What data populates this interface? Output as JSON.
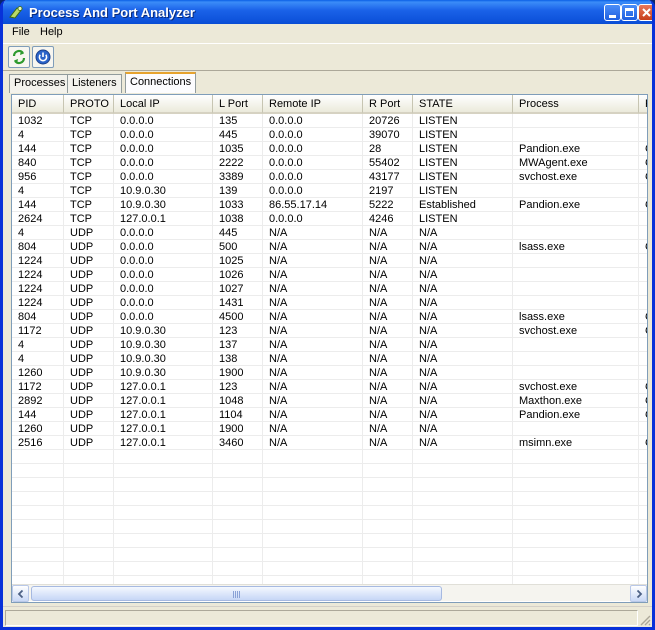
{
  "window": {
    "title": "Process And Port Analyzer"
  },
  "menu": {
    "items": [
      {
        "label": "File"
      },
      {
        "label": "Help"
      }
    ]
  },
  "toolbar": {
    "buttons": [
      {
        "icon": "refresh-icon"
      },
      {
        "icon": "power-icon"
      }
    ]
  },
  "tabs": [
    {
      "label": "Processes",
      "active": false
    },
    {
      "label": "Listeners",
      "active": false
    },
    {
      "label": "Connections",
      "active": true
    }
  ],
  "table": {
    "columns": [
      "PID",
      "PROTO",
      "Local IP",
      "L Port",
      "Remote IP",
      "R Port",
      "STATE",
      "Process",
      "F"
    ],
    "rows": [
      [
        "1032",
        "TCP",
        "0.0.0.0",
        "135",
        "0.0.0.0",
        "20726",
        "LISTEN",
        "",
        ""
      ],
      [
        "4",
        "TCP",
        "0.0.0.0",
        "445",
        "0.0.0.0",
        "39070",
        "LISTEN",
        "",
        ""
      ],
      [
        "144",
        "TCP",
        "0.0.0.0",
        "1035",
        "0.0.0.0",
        "28",
        "LISTEN",
        "Pandion.exe",
        "C"
      ],
      [
        "840",
        "TCP",
        "0.0.0.0",
        "2222",
        "0.0.0.0",
        "55402",
        "LISTEN",
        "MWAgent.exe",
        "C"
      ],
      [
        "956",
        "TCP",
        "0.0.0.0",
        "3389",
        "0.0.0.0",
        "43177",
        "LISTEN",
        "svchost.exe",
        "C"
      ],
      [
        "4",
        "TCP",
        "10.9.0.30",
        "139",
        "0.0.0.0",
        "2197",
        "LISTEN",
        "",
        ""
      ],
      [
        "144",
        "TCP",
        "10.9.0.30",
        "1033",
        "86.55.17.14",
        "5222",
        "Established",
        "Pandion.exe",
        "C"
      ],
      [
        "2624",
        "TCP",
        "127.0.0.1",
        "1038",
        "0.0.0.0",
        "4246",
        "LISTEN",
        "",
        ""
      ],
      [
        "4",
        "UDP",
        "0.0.0.0",
        "445",
        "N/A",
        "N/A",
        "N/A",
        "",
        ""
      ],
      [
        "804",
        "UDP",
        "0.0.0.0",
        "500",
        "N/A",
        "N/A",
        "N/A",
        "lsass.exe",
        "C"
      ],
      [
        "1224",
        "UDP",
        "0.0.0.0",
        "1025",
        "N/A",
        "N/A",
        "N/A",
        "",
        ""
      ],
      [
        "1224",
        "UDP",
        "0.0.0.0",
        "1026",
        "N/A",
        "N/A",
        "N/A",
        "",
        ""
      ],
      [
        "1224",
        "UDP",
        "0.0.0.0",
        "1027",
        "N/A",
        "N/A",
        "N/A",
        "",
        ""
      ],
      [
        "1224",
        "UDP",
        "0.0.0.0",
        "1431",
        "N/A",
        "N/A",
        "N/A",
        "",
        ""
      ],
      [
        "804",
        "UDP",
        "0.0.0.0",
        "4500",
        "N/A",
        "N/A",
        "N/A",
        "lsass.exe",
        "C"
      ],
      [
        "1172",
        "UDP",
        "10.9.0.30",
        "123",
        "N/A",
        "N/A",
        "N/A",
        "svchost.exe",
        "C"
      ],
      [
        "4",
        "UDP",
        "10.9.0.30",
        "137",
        "N/A",
        "N/A",
        "N/A",
        "",
        ""
      ],
      [
        "4",
        "UDP",
        "10.9.0.30",
        "138",
        "N/A",
        "N/A",
        "N/A",
        "",
        ""
      ],
      [
        "1260",
        "UDP",
        "10.9.0.30",
        "1900",
        "N/A",
        "N/A",
        "N/A",
        "",
        ""
      ],
      [
        "1172",
        "UDP",
        "127.0.0.1",
        "123",
        "N/A",
        "N/A",
        "N/A",
        "svchost.exe",
        "C"
      ],
      [
        "2892",
        "UDP",
        "127.0.0.1",
        "1048",
        "N/A",
        "N/A",
        "N/A",
        "Maxthon.exe",
        "C"
      ],
      [
        "144",
        "UDP",
        "127.0.0.1",
        "1104",
        "N/A",
        "N/A",
        "N/A",
        "Pandion.exe",
        "C"
      ],
      [
        "1260",
        "UDP",
        "127.0.0.1",
        "1900",
        "N/A",
        "N/A",
        "N/A",
        "",
        ""
      ],
      [
        "2516",
        "UDP",
        "127.0.0.1",
        "3460",
        "N/A",
        "N/A",
        "N/A",
        "msimn.exe",
        "C"
      ]
    ]
  },
  "colors": {
    "titlebar": "#0b4fd8",
    "tab_highlight": "#e6a32e",
    "face": "#ece9d8"
  }
}
